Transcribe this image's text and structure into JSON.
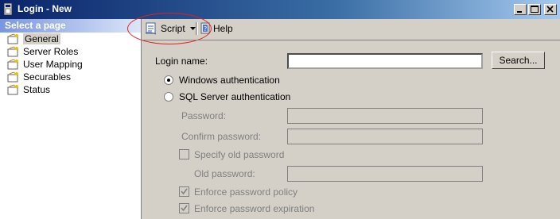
{
  "window": {
    "title": "Login - New"
  },
  "left_pane": {
    "header": "Select a page",
    "pages": [
      {
        "label": "General",
        "selected": true
      },
      {
        "label": "Server Roles"
      },
      {
        "label": "User Mapping"
      },
      {
        "label": "Securables"
      },
      {
        "label": "Status"
      }
    ]
  },
  "toolbar": {
    "script_label": "Script",
    "help_label": "Help"
  },
  "form": {
    "login_name_label": "Login name:",
    "login_name_value": "",
    "search_button": "Search...",
    "windows_auth_label": "Windows authentication",
    "windows_auth_selected": true,
    "sql_auth_label": "SQL Server authentication",
    "password_label": "Password:",
    "confirm_password_label": "Confirm password:",
    "specify_old_password_label": "Specify old password",
    "old_password_label": "Old password:",
    "enforce_policy_label": "Enforce password policy",
    "enforce_policy_checked": true,
    "enforce_expiration_label": "Enforce password expiration",
    "enforce_expiration_checked": true
  },
  "colors": {
    "title_bar": "#0a246a",
    "annotation_ring": "#e02020",
    "window_bg": "#d4d0c8"
  }
}
